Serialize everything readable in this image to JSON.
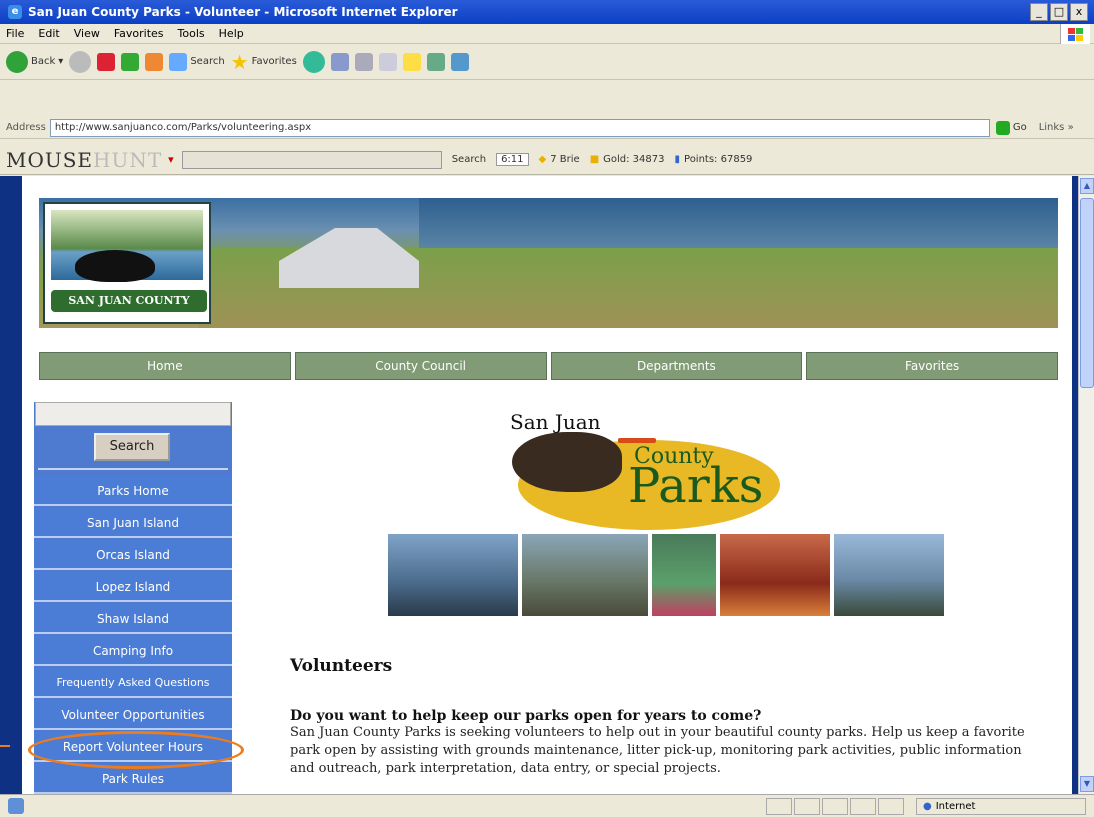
{
  "window": {
    "title": "San Juan County Parks - Volunteer - Microsoft Internet Explorer",
    "controls": [
      "_",
      "□",
      "x"
    ]
  },
  "menu": [
    "File",
    "Edit",
    "View",
    "Favorites",
    "Tools",
    "Help"
  ],
  "toolbar": {
    "back": "Back",
    "search": "Search",
    "favorites": "Favorites"
  },
  "address": {
    "label": "Address",
    "url": "http://www.sanjuanco.com/Parks/volunteering.aspx",
    "go": "Go",
    "links": "Links »"
  },
  "mousehunt": {
    "brand_a": "MOUSE",
    "brand_b": "HUNT",
    "search": "Search",
    "time": "6:11",
    "bait": "7 Brie",
    "gold": "Gold: 34873",
    "points": "Points: 67859"
  },
  "site": {
    "logo_text": "SAN JUAN COUNTY",
    "nav": [
      "Home",
      "County Council",
      "Departments",
      "Favorites"
    ],
    "sidebar": {
      "search_button": "Search",
      "items": [
        "Parks Home",
        "San Juan Island",
        "Orcas Island",
        "Lopez Island",
        "Shaw Island",
        "Camping Info",
        "Frequently Asked Questions",
        "Volunteer Opportunities",
        "Report Volunteer Hours",
        "Park Rules"
      ]
    },
    "parks_logo": {
      "line1": "San Juan",
      "line2": "County",
      "line3": "Parks"
    },
    "heading": "Volunteers",
    "question": "Do you want to help keep our parks open for years to come?",
    "body": "San Juan County Parks is seeking volunteers to help out in your beautiful county parks. Help us keep a favorite park open by assisting with grounds maintenance, litter pick-up, monitoring park activities, public information and outreach, park interpretation, data entry, or special projects."
  },
  "status": {
    "zone": "Internet"
  },
  "colors": {
    "titlebar": "#0b3fc4",
    "nav_green": "#809b76",
    "sidebar_blue": "#4c7dd6",
    "highlight": "#ee7b1c",
    "frame_blue": "#0e3184"
  }
}
